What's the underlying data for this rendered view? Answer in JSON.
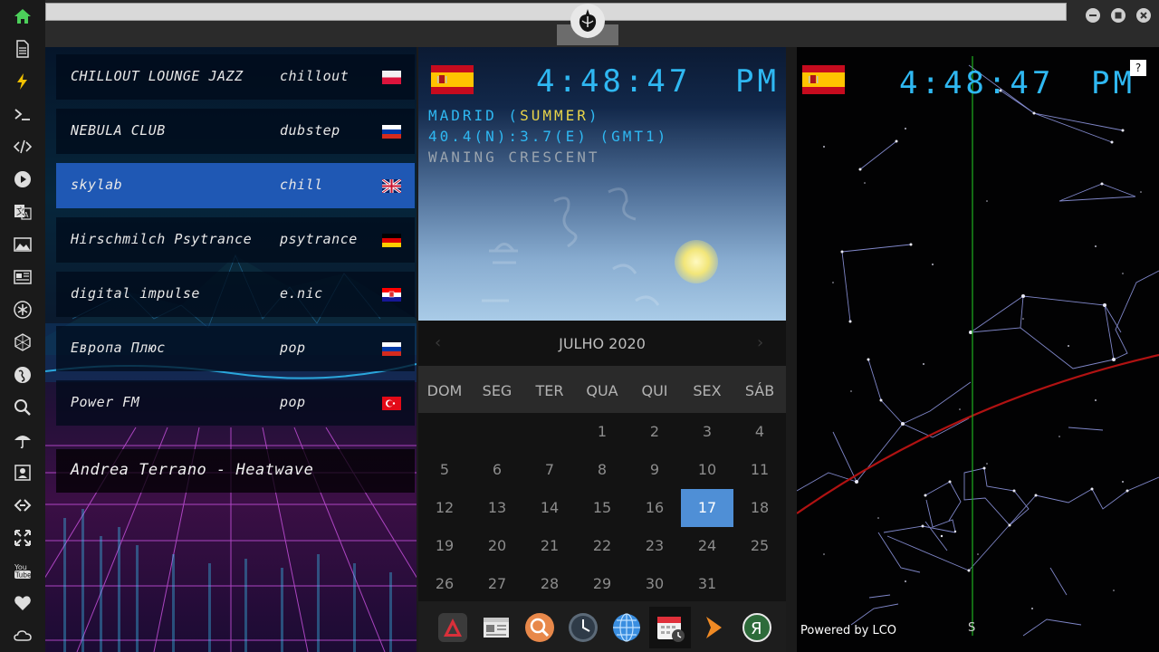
{
  "sidebar": {
    "icons": [
      "home-icon",
      "document-icon",
      "lightning-icon",
      "terminal-icon",
      "code-icon",
      "play-icon",
      "translate-icon",
      "image-icon",
      "news-icon",
      "asterisk-icon",
      "hexagon-icon",
      "globe-icon",
      "search-icon",
      "umbrella-icon",
      "contact-card-icon",
      "link-icon",
      "expand-icon",
      "youtube-icon",
      "heart-icon",
      "cloud-icon"
    ]
  },
  "topbar": {
    "window_controls": [
      "minimize",
      "maximize",
      "close"
    ]
  },
  "radio": {
    "stations": [
      {
        "name": "CHILLOUT LOUNGE JAZZ",
        "genre": "chillout",
        "flag": "poland"
      },
      {
        "name": "NEBULA CLUB",
        "genre": "dubstep",
        "flag": "russia"
      },
      {
        "name": "skylab",
        "genre": "chill",
        "flag": "uk"
      },
      {
        "name": "Hirschmilch Psytrance",
        "genre": "psytrance",
        "flag": "germany"
      },
      {
        "name": "digital impulse",
        "genre": "e.nic",
        "flag": "croatia"
      },
      {
        "name": "Европа Плюс",
        "genre": "pop",
        "flag": "russia"
      },
      {
        "name": "Power FM",
        "genre": "pop",
        "flag": "turkey"
      }
    ],
    "active_index": 2,
    "now_playing": "Andrea Terrano - Heatwave"
  },
  "clock": {
    "time": "4:48:47",
    "ampm": "PM",
    "city_prefix": "MADRID (",
    "season": "SUMMER",
    "city_suffix": ")",
    "coords": "40.4(N):3.7(E) (GMT1)",
    "moon_phase": "WANING CRESCENT",
    "colors": {
      "digits": "#2fb8f2",
      "season": "#e8d44a"
    }
  },
  "calendar": {
    "month_label": "JULHO 2020",
    "weekdays": [
      "DOM",
      "SEG",
      "TER",
      "QUA",
      "QUI",
      "SEX",
      "SÁB"
    ],
    "first_weekday_index": 3,
    "days_in_month": 31,
    "today": 17,
    "prev_arrow": "‹",
    "next_arrow": "›",
    "today_color": "#4f8fd6"
  },
  "dock": {
    "apps": [
      "anki-icon",
      "news-reader-icon",
      "search-app-icon",
      "clock-app-icon",
      "globe-app-icon",
      "calendar-app-icon",
      "arrow-app-icon",
      "yandex-icon"
    ],
    "selected": 5
  },
  "skymap": {
    "help_label": "?",
    "powered_by": "Powered by LCO",
    "direction": "S"
  }
}
